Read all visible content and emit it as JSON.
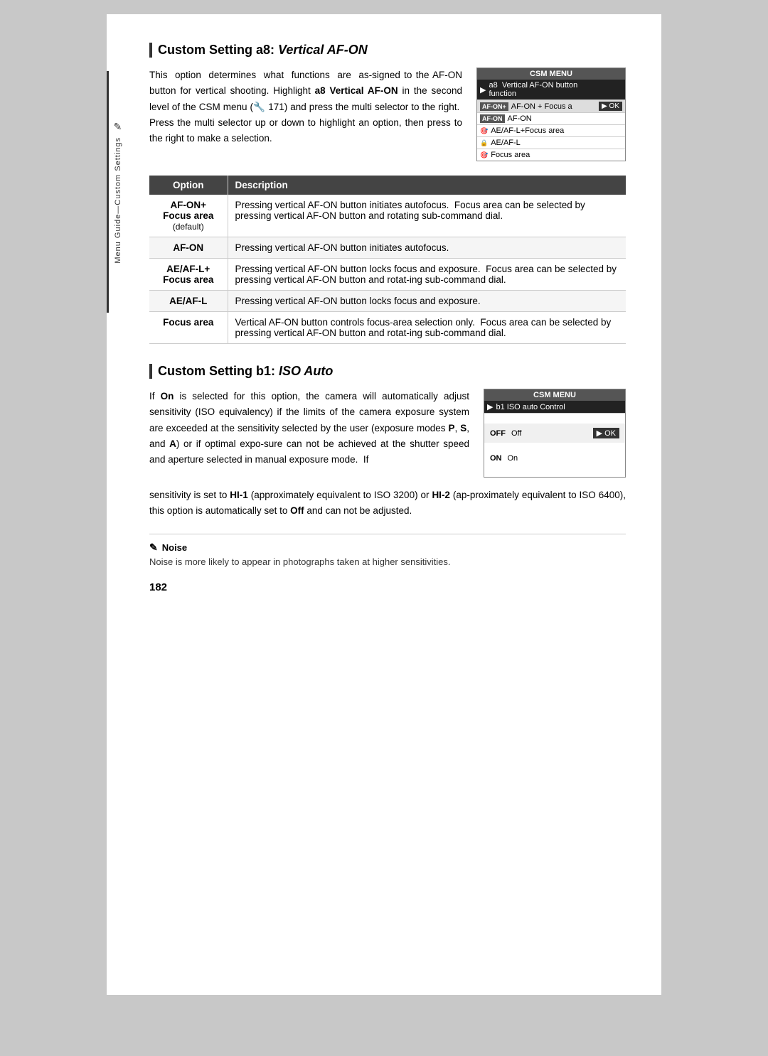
{
  "page": {
    "number": "182",
    "sidebar": {
      "icon": "✎",
      "text": "Menu Guide—Custom Settings"
    },
    "section_a8": {
      "heading_prefix": "Custom Setting a8: ",
      "heading_italic": "Vertical AF-ON",
      "body_text_1": "This  option  determines  what  functions  are  as-signed to the AF-ON button for vertical shooting. Highlight ",
      "body_bold_1": "a8 Vertical AF-ON",
      "body_text_2": " in the second level of the CSM menu (",
      "body_ref": "🔧 171",
      "body_text_3": ") and press the multi selector to the right.  Press the multi selector up or down to highlight an option, then press to the right to make a selection.",
      "csm_menu": {
        "title": "CSM MENU",
        "rows": [
          {
            "icon": "▶",
            "label": "a8  Vertical AF-ON button function",
            "highlighted": true,
            "ok": false
          },
          {
            "icon": "AF-ON+",
            "label": "AF-ON + Focus a",
            "highlighted": false,
            "ok": true,
            "camera_icon": true
          },
          {
            "icon": "AF-ON",
            "label": "AF-ON",
            "highlighted": false,
            "ok": false
          },
          {
            "icon": "AE/AF-L+",
            "label": "AE/AF-L+Focus area",
            "highlighted": false,
            "ok": false
          },
          {
            "icon": "AE/AF-L",
            "label": "AE/AF-L",
            "highlighted": false,
            "ok": false
          },
          {
            "icon": "🎯",
            "label": "Focus area",
            "highlighted": false,
            "ok": false
          }
        ]
      },
      "table": {
        "col_option": "Option",
        "col_desc": "Description",
        "rows": [
          {
            "option": "AF-ON+\nFocus area\n(default)",
            "description": "Pressing vertical AF-ON button initiates autofocus.  Focus area can be selected by pressing vertical AF-ON button and rotating sub-command dial."
          },
          {
            "option": "AF-ON",
            "description": "Pressing vertical AF-ON button initiates autofocus."
          },
          {
            "option": "AE/AF-L+\nFocus area",
            "description": "Pressing vertical AF-ON button locks focus and exposure.  Focus area can be selected by pressing vertical AF-ON button and rotat-ing sub-command dial."
          },
          {
            "option": "AE/AF-L",
            "description": "Pressing vertical AF-ON button locks focus and exposure."
          },
          {
            "option": "Focus area",
            "description": "Vertical AF-ON button controls focus-area selection only.  Focus area can be selected by pressing vertical AF-ON button and rotat-ing sub-command dial."
          }
        ]
      }
    },
    "section_b1": {
      "heading_prefix": "Custom Setting b1: ",
      "heading_italic": "ISO Auto",
      "body_text_1": "If ",
      "body_bold_1": "On",
      "body_text_2": " is selected for this option, the camera will automatically adjust sensitivity (ISO equivalency) if the limits of the camera exposure system are exceeded at the sensitivity selected by the user (exposure modes ",
      "body_bold_2": "P",
      "body_text_3": ", ",
      "body_bold_3": "S",
      "body_text_4": ", and ",
      "body_bold_4": "A",
      "body_text_5": ") or if optimal expo-sure can not be achieved at the shutter speed and aperture selected in manual exposure mode.  If",
      "csm_menu": {
        "title": "CSM MENU",
        "row_title": "b1  ISO auto Control",
        "row_off_code": "OFF",
        "row_off_label": "Off",
        "row_on_code": "ON",
        "row_on_label": "On"
      },
      "continued_text": "sensitivity is set to ",
      "continued_bold_1": "HI-1",
      "continued_text_2": " (approximately equivalent to ISO 3200) or ",
      "continued_bold_2": "HI-2",
      "continued_text_3": " (ap-proximately equivalent to ISO 6400), this option is automatically set to ",
      "continued_bold_3": "Off",
      "continued_text_4": " and can not be adjusted.",
      "note": {
        "icon": "✎",
        "title": "Noise",
        "text": "Noise is more likely to appear in photographs taken at higher sensitivities."
      }
    }
  }
}
